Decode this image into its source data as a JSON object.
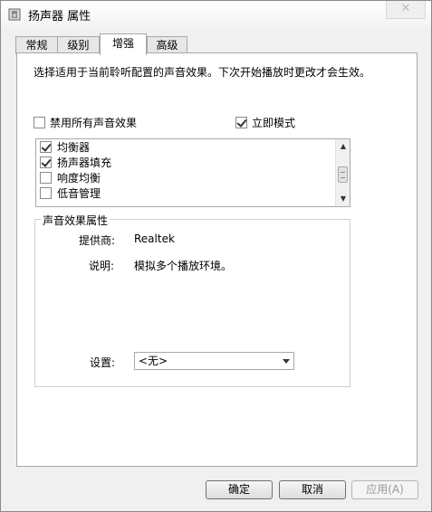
{
  "window": {
    "title": "扬声器 属性",
    "close_glyph": "✕"
  },
  "tabs": [
    {
      "label": "常规"
    },
    {
      "label": "级别"
    },
    {
      "label": "增强",
      "active": true
    },
    {
      "label": "高级"
    }
  ],
  "enhance": {
    "description": "选择适用于当前聆听配置的声音效果。下次开始播放时更改才会生效。",
    "disable_all": {
      "label": "禁用所有声音效果",
      "checked": false
    },
    "immediate_mode": {
      "label": "立即模式",
      "checked": true
    },
    "effects": [
      {
        "label": "均衡器",
        "checked": true
      },
      {
        "label": "扬声器填充",
        "checked": true
      },
      {
        "label": "响度均衡",
        "checked": false
      },
      {
        "label": "低音管理",
        "checked": false
      }
    ],
    "properties": {
      "title": "声音效果属性",
      "provider_label": "提供商:",
      "provider_value": "Realtek",
      "description_label": "说明:",
      "description_value": "模拟多个播放环境。",
      "settings_label": "设置:",
      "settings_value": "<无>"
    }
  },
  "buttons": {
    "ok": "确定",
    "cancel": "取消",
    "apply": "应用(A)"
  },
  "colors": {
    "window_bg": "#f0f0f0",
    "panel_bg": "#ffffff",
    "border": "#a8a8a8"
  }
}
